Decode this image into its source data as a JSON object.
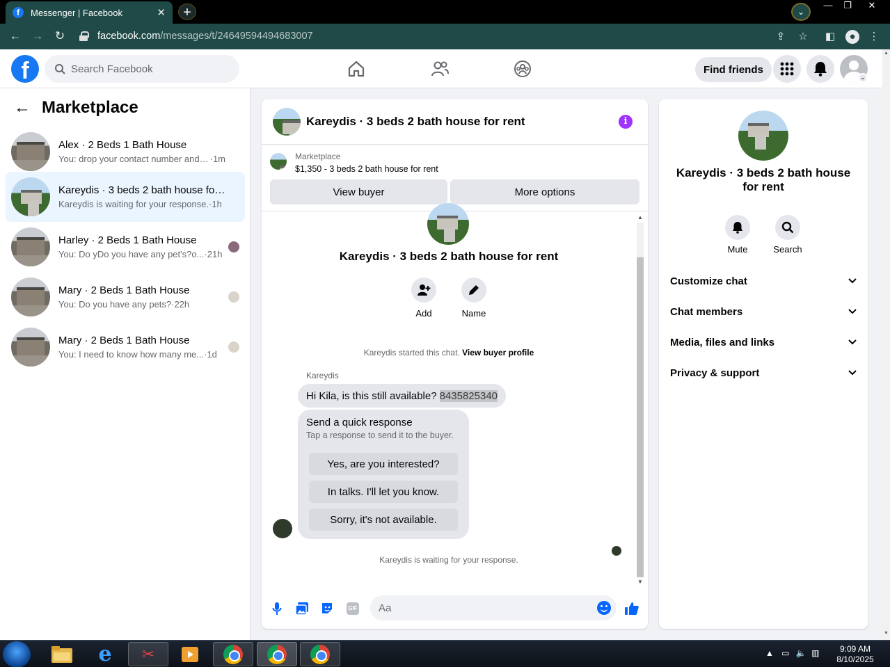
{
  "browser": {
    "tab_title": "Messenger | Facebook",
    "url_domain": "facebook.com",
    "url_path": "/messages/t/24649594494683007"
  },
  "header": {
    "search_placeholder": "Search Facebook",
    "find_friends": "Find friends"
  },
  "sidebar": {
    "title": "Marketplace",
    "conversations": [
      {
        "name": "Alex · 2 Beds 1 Bath House",
        "snippet": "You: drop your contact number and n...",
        "time": "·1m",
        "active": false
      },
      {
        "name": "Kareydis · 3 beds 2 bath house for ...",
        "snippet": "Kareydis is waiting for your response.",
        "time": "·1h",
        "active": true
      },
      {
        "name": "Harley · 2 Beds 1 Bath House",
        "snippet": "You: Do yDo you have any pet's?o...",
        "time": "·21h",
        "active": false
      },
      {
        "name": "Mary · 2 Beds 1 Bath House",
        "snippet": "You: Do you have any pets?",
        "time": "·22h",
        "active": false
      },
      {
        "name": "Mary · 2 Beds 1 Bath House",
        "snippet": "You: I need to know how many me...",
        "time": "·1d",
        "active": false
      }
    ]
  },
  "chat": {
    "title": "Kareydis · 3 beds 2 bath house for rent",
    "listing_label": "Marketplace",
    "listing_price": "$1,350 - 3 beds 2 bath house for rent",
    "view_buyer": "View buyer",
    "more_options": "More options",
    "center_title": "Kareydis · 3 beds 2 bath house for rent",
    "add_label": "Add",
    "name_label": "Name",
    "started_text": "Kareydis started this chat.",
    "view_profile": "View buyer profile",
    "sender": "Kareydis",
    "message_text": "Hi Kila, is this still available?",
    "message_number": "8435825340",
    "quick_title": "Send a quick response",
    "quick_sub": "Tap a response to send it to the buyer.",
    "quick_replies": [
      "Yes, are you interested?",
      "In talks. I'll let you know.",
      "Sorry, it's not available."
    ],
    "waiting_text": "Kareydis is waiting for your response.",
    "input_placeholder": "Aa"
  },
  "right_panel": {
    "title": "Kareydis · 3 beds 2 bath house for rent",
    "mute": "Mute",
    "search": "Search",
    "sections": [
      "Customize chat",
      "Chat members",
      "Media, files and links",
      "Privacy & support"
    ]
  },
  "taskbar": {
    "time": "9:09 AM",
    "date": "8/10/2025"
  },
  "colors": {
    "fb_blue": "#1877f2",
    "messenger_blue": "#0866ff",
    "info_purple": "#a033ff",
    "chrome_frame": "#1f4a47"
  }
}
